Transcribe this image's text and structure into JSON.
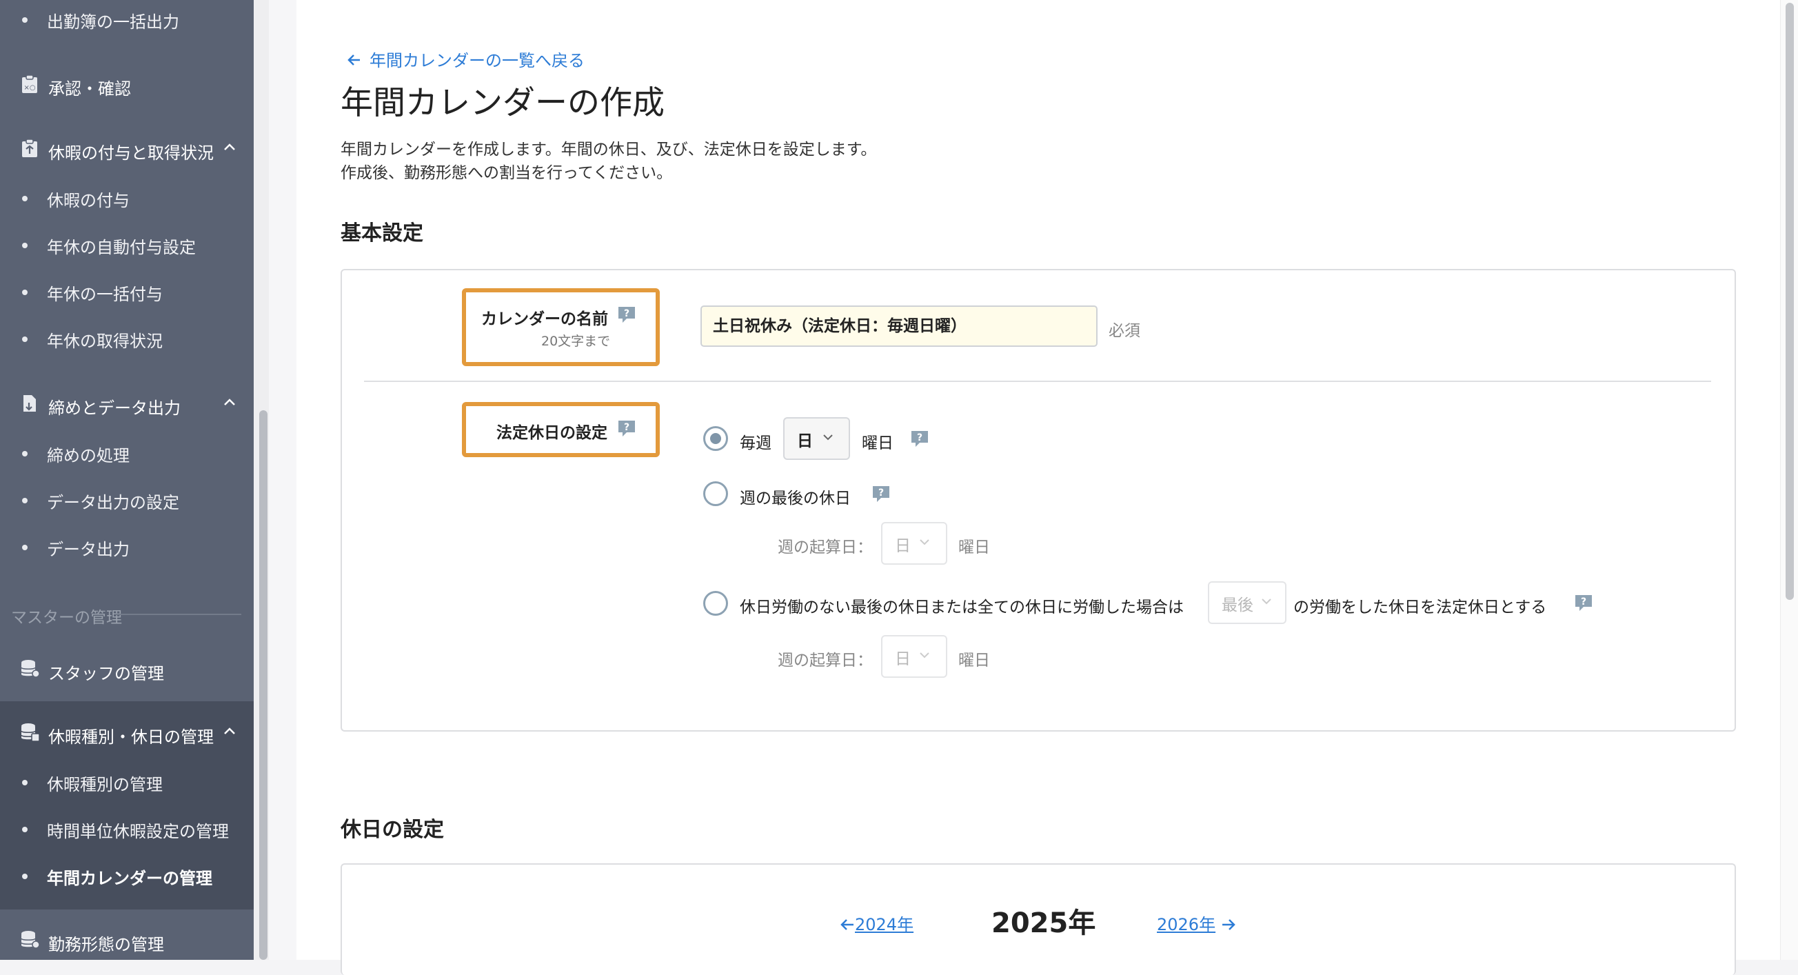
{
  "sidebar": {
    "top_item": "出勤簿の一括出力",
    "approval": "承認・確認",
    "leave_group": {
      "label": "休暇の付与と取得状況",
      "items": [
        "休暇の付与",
        "年休の自動付与設定",
        "年休の一括付与",
        "年休の取得状況"
      ]
    },
    "closing_group": {
      "label": "締めとデータ出力",
      "items": [
        "締めの処理",
        "データ出力の設定",
        "データ出力"
      ]
    },
    "master_section": "マスターの管理",
    "staff": "スタッフの管理",
    "holiday_group": {
      "label": "休暇種別・休日の管理",
      "items": [
        "休暇種別の管理",
        "時間単位休暇設定の管理",
        "年間カレンダーの管理"
      ]
    },
    "work_pattern": "勤務形態の管理"
  },
  "page": {
    "back_link": "年間カレンダーの一覧へ戻る",
    "title": "年間カレンダーの作成",
    "description_line1": "年間カレンダーを作成します。年間の休日、及び、法定休日を設定します。",
    "description_line2": "作成後、勤務形態への割当を行ってください。"
  },
  "basic_settings": {
    "heading": "基本設定",
    "calendar_name": {
      "label": "カレンダーの名前",
      "sublabel": "20文字まで",
      "value": "土日祝休み（法定休日：毎週日曜）",
      "required": "必須"
    },
    "legal_holiday": {
      "label": "法定休日の設定",
      "option_weekly": {
        "prefix": "毎週",
        "day": "日",
        "suffix": "曜日",
        "selected": true
      },
      "option_last_holiday": {
        "label": "週の最後の休日",
        "start_label": "週の起算日：",
        "start_day": "日",
        "start_suffix": "曜日",
        "selected": false
      },
      "option_no_work": {
        "prefix": "休日労働のない最後の休日または全ての休日に労働した場合は",
        "select": "最後",
        "suffix": "の労働をした休日を法定休日とする",
        "start_label": "週の起算日：",
        "start_day": "日",
        "start_suffix": "曜日",
        "selected": false
      }
    }
  },
  "holiday_settings": {
    "heading": "休日の設定",
    "prev_year": "2024年",
    "current_year": "2025年",
    "next_year": "2026年"
  },
  "colors": {
    "sidebar_bg": "#5a6273",
    "sidebar_active_bg": "#474e5d",
    "link": "#2d7cd6",
    "highlight": "#e39a3c",
    "input_bg": "#fffcea"
  }
}
